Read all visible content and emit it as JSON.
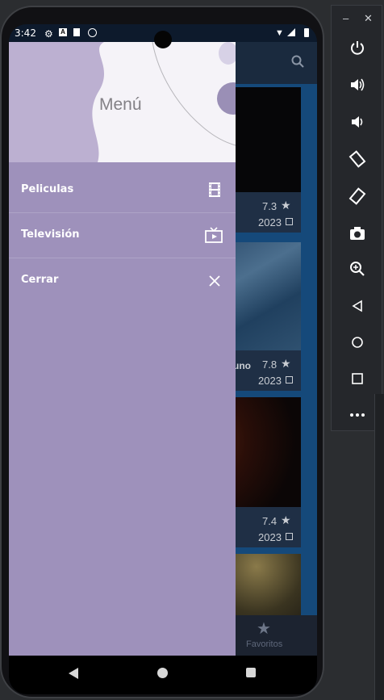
{
  "status_bar": {
    "time": "3:42",
    "indicator_letter": "A"
  },
  "app": {
    "movies": [
      {
        "rating": "7.3",
        "year": "2023",
        "title_fragment": ""
      },
      {
        "rating": "7.8",
        "year": "2023",
        "title_fragment": "uno"
      },
      {
        "rating": "7.4",
        "year": "2023",
        "title_fragment": ""
      }
    ],
    "bottom_nav_label": "Favoritos"
  },
  "drawer": {
    "title": "Menú",
    "items": [
      {
        "label": "Peliculas",
        "icon": "film-icon"
      },
      {
        "label": "Televisión",
        "icon": "tv-icon"
      },
      {
        "label": "Cerrar",
        "icon": "close-icon"
      }
    ]
  },
  "colors": {
    "drawer_bg": "#9e91bb",
    "header_bg": "#f5f3f8",
    "accent_blue": "#15497a"
  },
  "emulator_toolbar": {
    "buttons": [
      "power-icon",
      "volume-up-icon",
      "volume-down-icon",
      "rotate-left-icon",
      "rotate-right-icon",
      "camera-icon",
      "zoom-icon",
      "back-icon",
      "home-icon",
      "overview-icon",
      "more-icon"
    ]
  }
}
